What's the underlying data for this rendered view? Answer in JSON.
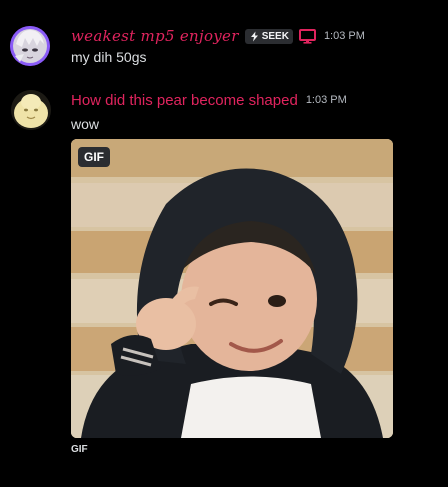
{
  "messages": [
    {
      "username": "weakest mp5 enjoyer",
      "tag": {
        "icon": "lightning-icon",
        "label": "SEEK"
      },
      "device_icon": "monitor-icon",
      "time": "1:03 PM",
      "text": "my dih 50gs",
      "avatar": "anime-character-avatar"
    },
    {
      "username": "How did this pear become shaped",
      "time": "1:03 PM",
      "text": "wow",
      "avatar": "pear-avatar",
      "attachment": {
        "type": "gif",
        "badge": "GIF",
        "caption": "GIF",
        "subject": "child in black hoodie winking and pinching fingers"
      }
    }
  ],
  "colors": {
    "background": "#000000",
    "username": "#e0245e",
    "text": "#dbdee1",
    "timestamp": "#b5bac1",
    "tag_bg": "#2b2d31",
    "device_red": "#e0245e",
    "avatar_ring": "#8a5cf6"
  }
}
